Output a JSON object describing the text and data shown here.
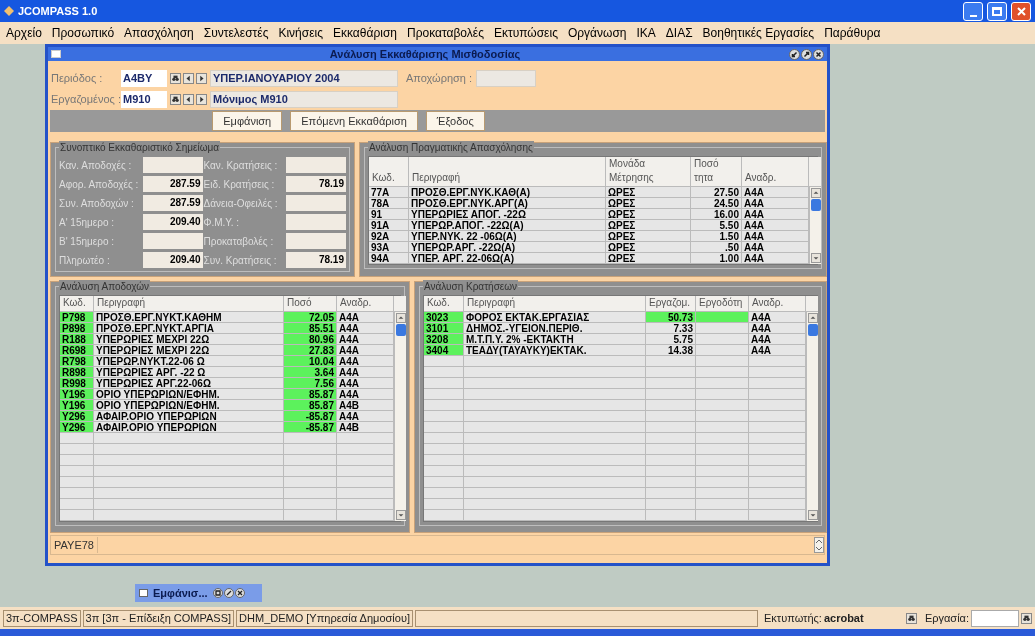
{
  "window": {
    "title": "JCOMPASS 1.0"
  },
  "menu": [
    "Αρχείο",
    "Προσωπικό",
    "Απασχόληση",
    "Συντελεστές",
    "Κινήσεις",
    "Εκκαθάριση",
    "Προκαταβολές",
    "Εκτυπώσεις",
    "Οργάνωση",
    "ΙΚΑ",
    "ΔΙΑΣ",
    "Βοηθητικές Εργασίες",
    "Παράθυρα"
  ],
  "frame": {
    "title": "Ανάλυση Εκκαθάρισης Μισθοδοσίας",
    "period": {
      "label": "Περιόδος :",
      "code": "A4BY",
      "name": "ΥΠΕΡ.ΙΑΝΟΥΑΡΙΟΥ 2004"
    },
    "leave": {
      "label": "Αποχώρηση :"
    },
    "employee": {
      "label": "Εργαζομένος :",
      "code": "M910",
      "name": "Μόνιμος M910"
    },
    "buttons": [
      "Εμφάνιση",
      "Επόμενη Εκκαθάριση",
      "Έξοδος"
    ],
    "summary": {
      "title": "Συνοπτικό Εκκαθαριστικό Σημείωμα",
      "rows": [
        {
          "left_label": "Καν. Αποδοχές :",
          "left_value": "",
          "right_label": "Καν. Κρατήσεις :",
          "right_value": ""
        },
        {
          "left_label": "Αφορ. Αποδοχές :",
          "left_value": "287.59",
          "right_label": "Ειδ. Κρατήσεις :",
          "right_value": "78.19"
        },
        {
          "left_label": "Συν. Αποδοχών :",
          "left_value": "287.59",
          "right_label": "Δάνεια-Οφειλές :",
          "right_value": ""
        },
        {
          "left_label": "Α' 15ημερο :",
          "left_value": "209.40",
          "right_label": "Φ.Μ.Υ. :",
          "right_value": ""
        },
        {
          "left_label": "Β' 15ημερο :",
          "left_value": "",
          "right_label": "Προκαταβολές :",
          "right_value": ""
        },
        {
          "left_label": "Πληρωτέο :",
          "left_value": "209.40",
          "right_label": "Συν. Κρατήσεις :",
          "right_value": "78.19"
        }
      ]
    },
    "work": {
      "title": "Ανάλυση Πραγματικής Απασχόλησης",
      "columns": [
        {
          "lines": [
            "Κωδ."
          ],
          "kind": "text"
        },
        {
          "lines": [
            "Περιγραφή"
          ],
          "kind": "text"
        },
        {
          "lines": [
            "Μονάδα",
            "Μέτρησης"
          ],
          "kind": "text"
        },
        {
          "lines": [
            "Ποσό",
            "τητα"
          ],
          "kind": "number"
        },
        {
          "lines": [
            "Αναδρ."
          ],
          "kind": "text"
        }
      ],
      "rows": [
        {
          "cells": [
            "77A",
            "ΠΡΟΣΘ.ΕΡΓ.ΝΥΚ.ΚΑΘ(Α)",
            "ΩΡΕΣ",
            "27.50",
            "A4A"
          ]
        },
        {
          "cells": [
            "78A",
            "ΠΡΟΣΘ.ΕΡΓ.ΝΥΚ.ΑΡΓ(Α)",
            "ΩΡΕΣ",
            "24.50",
            "A4A"
          ]
        },
        {
          "cells": [
            "91",
            "ΥΠΕΡΩΡΙΕΣ ΑΠΟΓ. -22Ω",
            "ΩΡΕΣ",
            "16.00",
            "A4A"
          ]
        },
        {
          "cells": [
            "91A",
            "ΥΠΕΡΩΡ.ΑΠΟΓ. -22Ω(Α)",
            "ΩΡΕΣ",
            "5.50",
            "A4A"
          ]
        },
        {
          "cells": [
            "92A",
            "ΥΠΕΡ.ΝΥΚ. 22 -06Ω(Α)",
            "ΩΡΕΣ",
            "1.50",
            "A4A"
          ]
        },
        {
          "cells": [
            "93A",
            "ΥΠΕΡΩΡ.ΑΡΓ.  -22Ω(Α)",
            "ΩΡΕΣ",
            ".50",
            "A4A"
          ]
        },
        {
          "cells": [
            "94A",
            "ΥΠΕΡ. ΑΡΓ. 22-06Ω(Α)",
            "ΩΡΕΣ",
            "1.00",
            "A4A"
          ]
        }
      ]
    },
    "earnings": {
      "title": "Ανάλυση Αποδοχών",
      "columns": [
        {
          "lines": [
            "Κωδ."
          ],
          "kind": "code"
        },
        {
          "lines": [
            "Περιγραφή"
          ],
          "kind": "text"
        },
        {
          "lines": [
            "Ποσό"
          ],
          "kind": "number"
        },
        {
          "lines": [
            "Αναδρ."
          ],
          "kind": "text"
        }
      ],
      "rows": [
        {
          "cells": [
            "P798",
            "ΠΡΟΣΘ.ΕΡΓ.ΝΥΚΤ.ΚΑΘΗΜ",
            "72.05",
            "A4A"
          ],
          "highlighted": true
        },
        {
          "cells": [
            "P898",
            "ΠΡΟΣΘ.ΕΡΓ.ΝΥΚΤ.ΑΡΓΙΑ",
            "85.51",
            "A4A"
          ],
          "highlighted": true
        },
        {
          "cells": [
            "R188",
            "ΥΠΕΡΩΡΙΕΣ ΜΕΧΡΙ 22Ω",
            "80.96",
            "A4A"
          ],
          "highlighted": true
        },
        {
          "cells": [
            "R698",
            "ΥΠΕΡΩΡΙΕΣ ΜΕΧΡΙ 22Ω",
            "27.83",
            "A4A"
          ],
          "highlighted": true
        },
        {
          "cells": [
            "R798",
            "ΥΠΕΡΩΡ.ΝΥΚΤ.22-06 Ω",
            "10.04",
            "A4A"
          ],
          "highlighted": true
        },
        {
          "cells": [
            "R898",
            "ΥΠΕΡΩΡΙΕΣ ΑΡΓ. -22 Ω",
            "3.64",
            "A4A"
          ],
          "highlighted": true
        },
        {
          "cells": [
            "R998",
            "ΥΠΕΡΩΡΙΕΣ ΑΡΓ.22-06Ω",
            "7.56",
            "A4A"
          ],
          "highlighted": true
        },
        {
          "cells": [
            "Y196",
            "ΟΡΙΟ ΥΠΕΡΩΡΙΩΝ/ΕΦΗΜ.",
            "85.87",
            "A4A"
          ],
          "highlighted": true
        },
        {
          "cells": [
            "Y196",
            "ΟΡΙΟ ΥΠΕΡΩΡΙΩΝ/ΕΦΗΜ.",
            "85.87",
            "A4B"
          ],
          "highlighted": true
        },
        {
          "cells": [
            "Y296",
            "ΑΦΑΙΡ.ΟΡΙΟ ΥΠΕΡΩΡΙΩΝ",
            "-85.87",
            "A4A"
          ],
          "highlighted": true
        },
        {
          "cells": [
            "Y296",
            "ΑΦΑΙΡ.ΟΡΙΟ ΥΠΕΡΩΡΙΩΝ",
            "-85.87",
            "A4B"
          ],
          "highlighted": true
        }
      ]
    },
    "deductions": {
      "title": "Ανάλυση Κρατήσεων",
      "columns": [
        {
          "lines": [
            "Κωδ."
          ],
          "kind": "code"
        },
        {
          "lines": [
            "Περιγραφή"
          ],
          "kind": "text"
        },
        {
          "lines": [
            "Εργαζομ."
          ],
          "kind": "number"
        },
        {
          "lines": [
            "Εργοδότη"
          ],
          "kind": "number"
        },
        {
          "lines": [
            "Αναδρ."
          ],
          "kind": "text"
        }
      ],
      "rows": [
        {
          "cells": [
            "3023",
            "ΦΟΡΟΣ ΕΚΤΑΚ.ΕΡΓΑΣΙΑΣ",
            "50.73",
            "",
            "A4A"
          ],
          "highlighted": true
        },
        {
          "cells": [
            "3101",
            "ΔΗΜΟΣ.-ΥΓΕΙΟΝ.ΠΕΡΙΘ.",
            "7.33",
            "",
            "A4A"
          ],
          "highlighted": false
        },
        {
          "cells": [
            "3208",
            "Μ.Τ.Π.Υ. 2% -ΕΚΤΑΚΤΗ",
            "5.75",
            "",
            "A4A"
          ],
          "highlighted": false
        },
        {
          "cells": [
            "3404",
            "ΤΕΑΔΥ(ΤΑΥΑΥΚΥ)ΕΚΤΑΚ.",
            "14.38",
            "",
            "A4A"
          ],
          "highlighted": false
        }
      ]
    },
    "footer_field": {
      "value": "PAYE78"
    }
  },
  "minimized_frame": {
    "title": "Εμφάνισ..."
  },
  "status_bar": {
    "segments": [
      "3π-COMPASS",
      "3π [3π - Επίδειξη COMPASS]",
      "DHM_DEMO [Υπηρεσία Δημοσίου]"
    ],
    "printer": {
      "label": "Εκτυπωτής:",
      "value": "acrobat"
    },
    "job": {
      "label": "Εργασία:"
    }
  }
}
